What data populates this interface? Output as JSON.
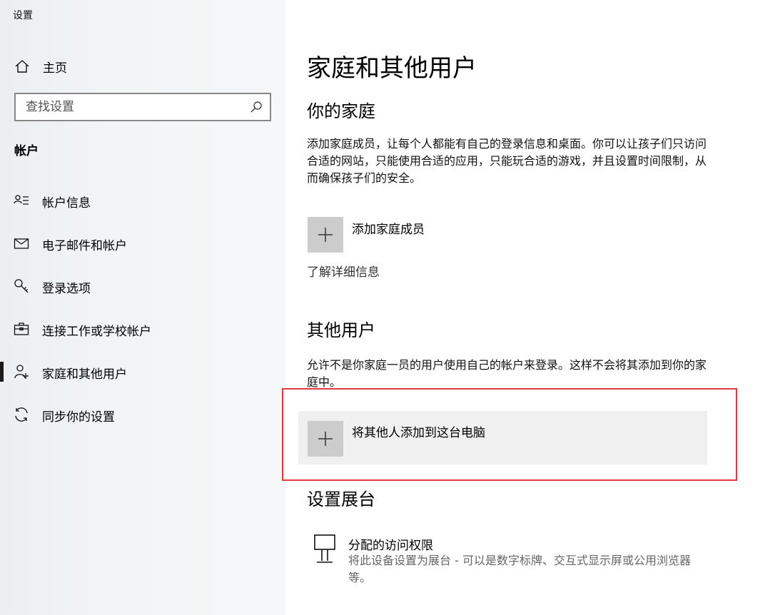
{
  "app": {
    "title": "设置"
  },
  "sidebar": {
    "home_label": "主页",
    "search_placeholder": "查找设置",
    "section_label": "帐户",
    "items": [
      {
        "label": "帐户信息",
        "icon": "account-info-icon"
      },
      {
        "label": "电子邮件和帐户",
        "icon": "mail-icon"
      },
      {
        "label": "登录选项",
        "icon": "key-icon"
      },
      {
        "label": "连接工作或学校帐户",
        "icon": "briefcase-icon"
      },
      {
        "label": "家庭和其他用户",
        "icon": "person-add-icon",
        "active": true
      },
      {
        "label": "同步你的设置",
        "icon": "sync-icon"
      }
    ]
  },
  "main": {
    "title": "家庭和其他用户",
    "family": {
      "heading": "你的家庭",
      "description": "添加家庭成员，让每个人都能有自己的登录信息和桌面。你可以让孩子们只访问合适的网站，只能使用合适的应用，只能玩合适的游戏，并且设置时间限制，从而确保孩子们的安全。",
      "add_label": "添加家庭成员",
      "learn_more": "了解详细信息"
    },
    "other": {
      "heading": "其他用户",
      "description": "允许不是你家庭一员的用户使用自己的帐户来登录。这样不会将其添加到你的家庭中。",
      "add_label": "将其他人添加到这台电脑"
    },
    "kiosk": {
      "heading": "设置展台",
      "title": "分配的访问权限",
      "description": "将此设备设置为展台 - 可以是数字标牌、交互式显示屏或公用浏览器等。"
    }
  },
  "colors": {
    "highlight": "#e0393e",
    "tile": "#cccccc",
    "row_bg": "#f0f0f0"
  }
}
